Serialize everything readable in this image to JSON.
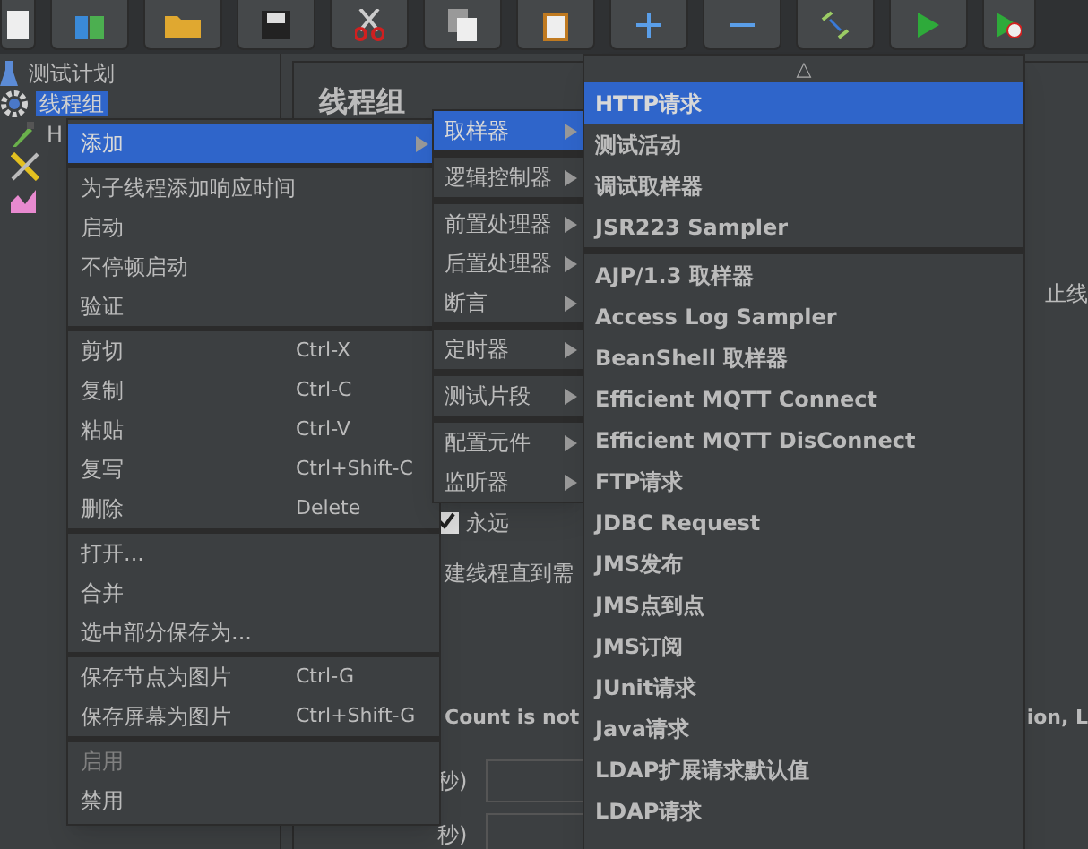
{
  "tree": [
    {
      "label": "测试计划",
      "selected": false
    },
    {
      "label": "线程组",
      "selected": true
    },
    {
      "label": "H",
      "selected": false
    }
  ],
  "panel": {
    "title": "线程组",
    "right_text_1": "止线",
    "loop_checkbox": {
      "label": "永远",
      "checked": true
    },
    "delay_text": "建线程直到需",
    "count_text": "Count is not",
    "right_text_2": "ion, L",
    "duration_label": "秒)",
    "delay_label": "秒)"
  },
  "context_menu": [
    {
      "label": "添加",
      "submenu": true,
      "selected": true,
      "disabled": false,
      "separator_before": false
    },
    {
      "label": "为子线程添加响应时间",
      "selected": false,
      "disabled": false,
      "separator_before": true
    },
    {
      "label": "启动",
      "selected": false,
      "disabled": false,
      "separator_before": false
    },
    {
      "label": "不停顿启动",
      "selected": false,
      "disabled": false,
      "separator_before": false
    },
    {
      "label": "验证",
      "selected": false,
      "disabled": false,
      "separator_before": false
    },
    {
      "label": "剪切",
      "shortcut": "Ctrl-X",
      "selected": false,
      "disabled": false,
      "separator_before": true
    },
    {
      "label": "复制",
      "shortcut": "Ctrl-C",
      "selected": false,
      "disabled": false,
      "separator_before": false
    },
    {
      "label": "粘贴",
      "shortcut": "Ctrl-V",
      "selected": false,
      "disabled": false,
      "separator_before": false
    },
    {
      "label": "复写",
      "shortcut": "Ctrl+Shift-C",
      "selected": false,
      "disabled": false,
      "separator_before": false
    },
    {
      "label": "删除",
      "shortcut": "Delete",
      "selected": false,
      "disabled": false,
      "separator_before": false
    },
    {
      "label": "打开...",
      "selected": false,
      "disabled": false,
      "separator_before": true
    },
    {
      "label": "合并",
      "selected": false,
      "disabled": false,
      "separator_before": false
    },
    {
      "label": "选中部分保存为...",
      "selected": false,
      "disabled": false,
      "separator_before": false
    },
    {
      "label": "保存节点为图片",
      "shortcut": "Ctrl-G",
      "selected": false,
      "disabled": false,
      "separator_before": true
    },
    {
      "label": "保存屏幕为图片",
      "shortcut": "Ctrl+Shift-G",
      "selected": false,
      "disabled": false,
      "separator_before": false
    },
    {
      "label": "启用",
      "selected": false,
      "disabled": true,
      "separator_before": true
    },
    {
      "label": "禁用",
      "selected": false,
      "disabled": false,
      "separator_before": false
    }
  ],
  "add_submenu": [
    {
      "label": "取样器",
      "selected": true,
      "separator_before": false
    },
    {
      "label": "逻辑控制器",
      "selected": false,
      "separator_before": true
    },
    {
      "label": "前置处理器",
      "selected": false,
      "separator_before": true
    },
    {
      "label": "后置处理器",
      "selected": false,
      "separator_before": false
    },
    {
      "label": "断言",
      "selected": false,
      "separator_before": false
    },
    {
      "label": "定时器",
      "selected": false,
      "separator_before": true
    },
    {
      "label": "测试片段",
      "selected": false,
      "separator_before": true
    },
    {
      "label": "配置元件",
      "selected": false,
      "separator_before": true
    },
    {
      "label": "监听器",
      "selected": false,
      "separator_before": false
    }
  ],
  "sampler_menu": {
    "scroll_up": "△",
    "items": [
      {
        "label": "HTTP请求",
        "selected": true,
        "separator_before": false
      },
      {
        "label": "测试活动",
        "selected": false,
        "separator_before": false
      },
      {
        "label": "调试取样器",
        "selected": false,
        "separator_before": false
      },
      {
        "label": "JSR223 Sampler",
        "selected": false,
        "separator_before": false
      },
      {
        "label": "AJP/1.3 取样器",
        "selected": false,
        "separator_before": true
      },
      {
        "label": "Access Log Sampler",
        "selected": false,
        "separator_before": false
      },
      {
        "label": "BeanShell 取样器",
        "selected": false,
        "separator_before": false
      },
      {
        "label": "Efficient MQTT Connect",
        "selected": false,
        "separator_before": false
      },
      {
        "label": "Efficient MQTT DisConnect",
        "selected": false,
        "separator_before": false
      },
      {
        "label": "FTP请求",
        "selected": false,
        "separator_before": false
      },
      {
        "label": "JDBC Request",
        "selected": false,
        "separator_before": false
      },
      {
        "label": "JMS发布",
        "selected": false,
        "separator_before": false
      },
      {
        "label": "JMS点到点",
        "selected": false,
        "separator_before": false
      },
      {
        "label": "JMS订阅",
        "selected": false,
        "separator_before": false
      },
      {
        "label": "JUnit请求",
        "selected": false,
        "separator_before": false
      },
      {
        "label": "Java请求",
        "selected": false,
        "separator_before": false
      },
      {
        "label": "LDAP扩展请求默认值",
        "selected": false,
        "separator_before": false
      },
      {
        "label": "LDAP请求",
        "selected": false,
        "separator_before": false
      }
    ]
  }
}
